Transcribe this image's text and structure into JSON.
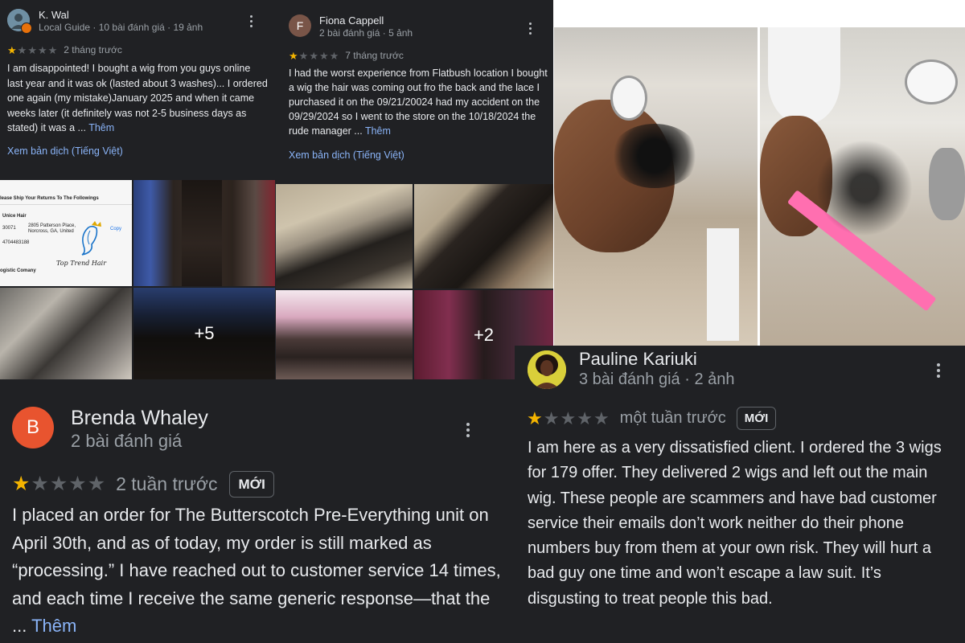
{
  "colors": {
    "background": "#202124",
    "text": "#e8eaed",
    "secondary": "#9aa0a6",
    "link": "#8ab4f8",
    "star_on": "#f4b400",
    "star_off": "#5f6368",
    "avatar_brenda": "#e8542f",
    "avatar_fiona": "#795548"
  },
  "review_kwal": {
    "name": "K. Wal",
    "meta": "Local Guide · 10 bài đánh giá · 19 ảnh",
    "rating": 1,
    "age": "2 tháng trước",
    "text": "I am disappointed! I bought a wig from you guys online last year and it was ok (lasted about 3 washes)... I ordered one again (my mistake)January 2025 and when it came weeks later (it definitely was not 2-5 business days as stated) it was a ...",
    "more": "Thêm",
    "translate": "Xem bản dịch (Tiếng Việt)",
    "photos": {
      "more_count": "+5",
      "return_label": {
        "heading": "lease Ship Your Returns To The Followings",
        "recipient": "Unice Hair",
        "address_code": "30071",
        "address": "2805 Patterson Place, Norcross, GA, United",
        "phone": "4704483188",
        "copy": "Copy",
        "footer": "ogistic Comany",
        "logo_script": "Top Trend Hair"
      }
    }
  },
  "review_fiona": {
    "initial": "F",
    "name": "Fiona Cappell",
    "meta": "2 bài đánh giá · 5 ảnh",
    "rating": 1,
    "age": "7 tháng trước",
    "text": "I had the worst experience from Flatbush location I bought a wig the hair was coming out fro the back and the lace I purchased it on the 09/21/20024 had my accident on the 09/29/2024 so I went to the store on the 10/18/2024 the rude manager ...",
    "more": "Thêm",
    "translate": "Xem bản dịch (Tiếng Việt)",
    "photos": {
      "more_count": "+2"
    }
  },
  "review_brenda": {
    "initial": "B",
    "name": "Brenda Whaley",
    "meta": "2 bài đánh giá",
    "rating": 1,
    "age": "2 tuần trước",
    "badge": "MỚI",
    "text": "I placed an order for The Butterscotch Pre-Everything unit on April 30th, and as of today, my order is still marked as “processing.” I have reached out to customer service 14 times, and each time I receive the same generic response—that the ...",
    "more": "Thêm"
  },
  "review_pauline": {
    "name": "Pauline Kariuki",
    "meta": "3 bài đánh giá · 2 ảnh",
    "rating": 1,
    "age": "một tuần trước",
    "badge": "MỚI",
    "text": "I am here as a very dissatisfied client. I ordered the 3 wigs for 179 offer. They delivered 2 wigs and left out the main wig. These people are scammers and have bad customer service their emails don’t work neither do their phone numbers buy from them at your own risk. They will hurt a bad guy one time and won’t escape a law suit. It’s disgusting to treat people this bad."
  }
}
